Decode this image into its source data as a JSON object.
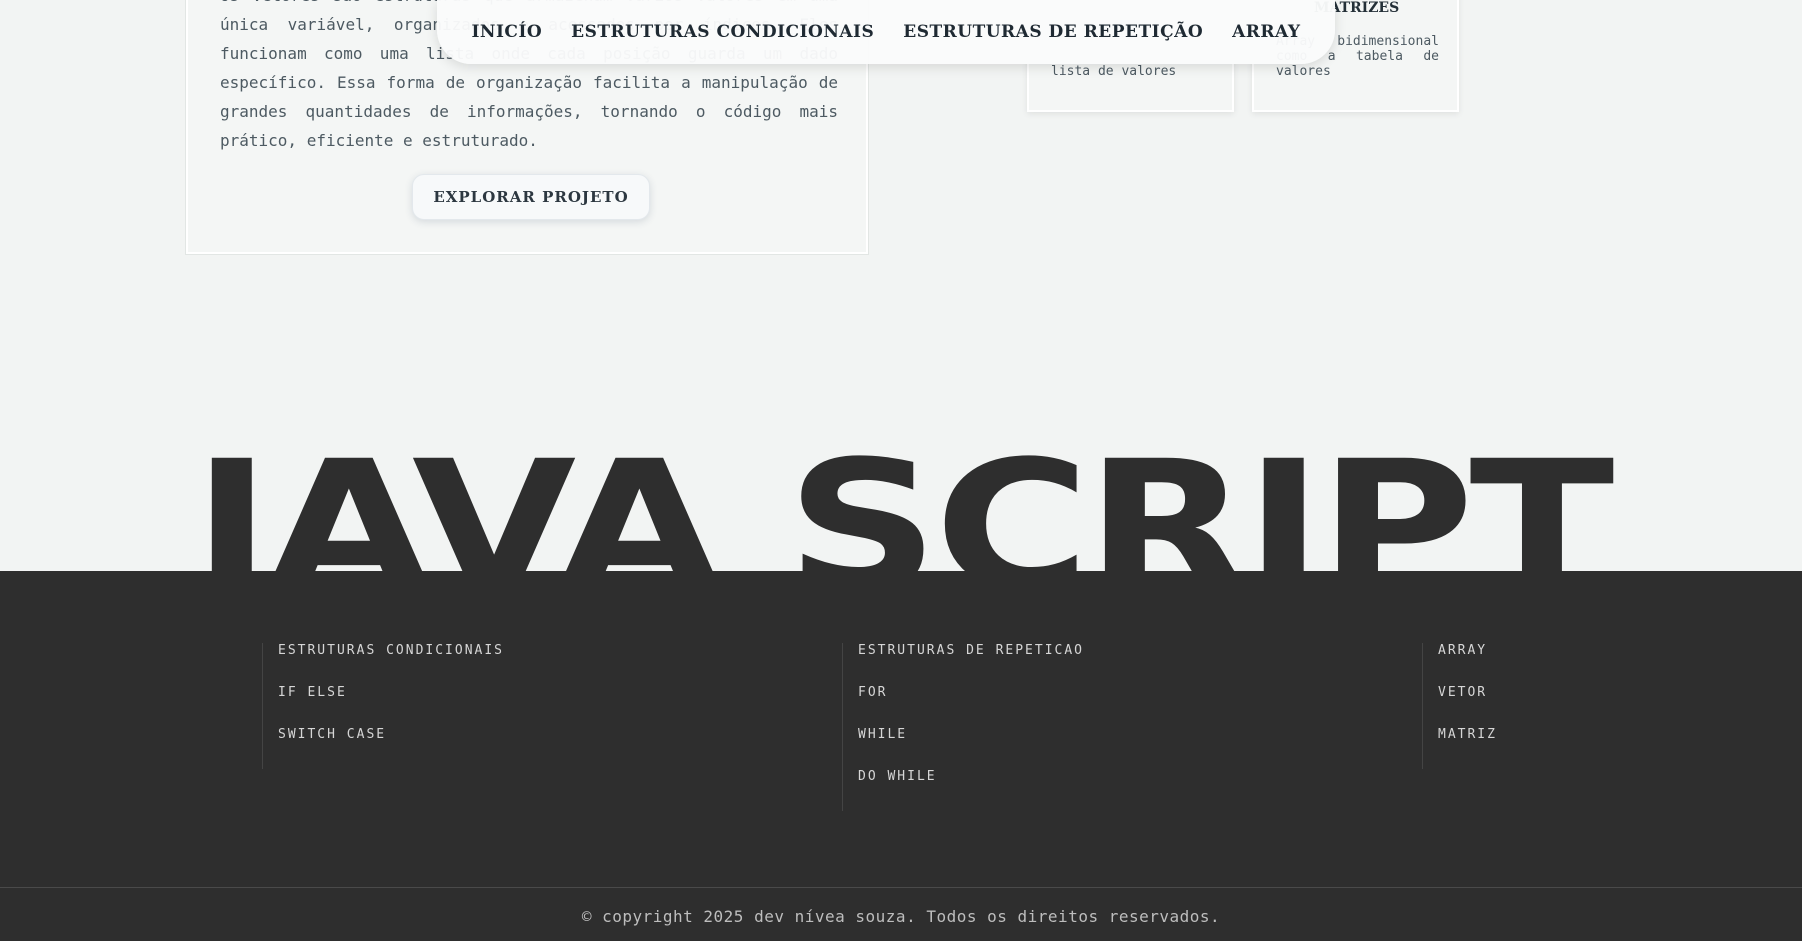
{
  "intro": {
    "paragraph": "Os vetores são estruturas que armazenam vários valores em uma única variável, organizados e acessados por índices. Eles funcionam como uma lista onde cada posição guarda um dado específico. Essa forma de organização facilita a manipulação de grandes quantidades de informações, tornando o código mais prático, eficiente e estruturado.",
    "button_label": "EXPLORAR PROJETO"
  },
  "cards": [
    {
      "title": "",
      "description": "lista de valores"
    },
    {
      "title": "MATRIZES",
      "description": "Array bidimensional como a tabela de valores"
    }
  ],
  "nav": {
    "items": [
      "INICÍO",
      "ESTRUTURAS CONDICIONAIS",
      "ESTRUTURAS DE REPETIÇÃO",
      "ARRAY"
    ]
  },
  "hero": {
    "title": "JAVA SCRIPT"
  },
  "footer": {
    "columns": [
      {
        "links": [
          "ESTRUTURAS CONDICIONAIS",
          "IF ELSE",
          "SWITCH CASE"
        ]
      },
      {
        "links": [
          "ESTRUTURAS DE REPETICAO",
          "FOR",
          "WHILE",
          "DO WHILE"
        ]
      },
      {
        "links": [
          "ARRAY",
          "VETOR",
          "MATRIZ"
        ]
      }
    ],
    "copyright": "© copyright 2025 dev nívea souza. Todos os direitos reservados."
  },
  "colors": {
    "background": "#f2f4f3",
    "footer_bg": "#2e2e2e",
    "text_dark": "#1f2a33"
  }
}
